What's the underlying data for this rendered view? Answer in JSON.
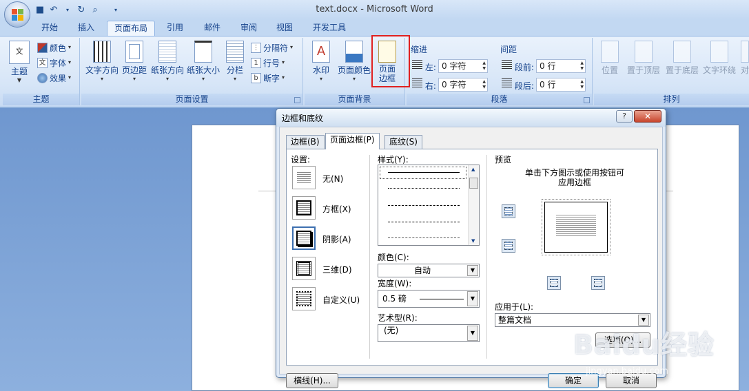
{
  "window": {
    "title": "text.docx - Microsoft Word"
  },
  "tabs": [
    "开始",
    "插入",
    "页面布局",
    "引用",
    "邮件",
    "审阅",
    "视图",
    "开发工具"
  ],
  "ribbon": {
    "themes": {
      "label": "主题",
      "theme_btn": "主题",
      "colors": "颜色",
      "fonts": "字体",
      "effects": "效果"
    },
    "page_setup": {
      "label": "页面设置",
      "text_direction": "文字方向",
      "margins": "页边距",
      "orientation": "纸张方向",
      "size": "纸张大小",
      "columns": "分栏",
      "breaks": "分隔符",
      "line_numbers": "行号",
      "hyphenation": "断字"
    },
    "page_background": {
      "label": "页面背景",
      "watermark": "水印",
      "page_color": "页面颜色",
      "page_borders_1": "页面",
      "page_borders_2": "边框"
    },
    "paragraph": {
      "label": "段落",
      "indent": "缩进",
      "left": "左:",
      "right": "右:",
      "left_val": "0 字符",
      "right_val": "0 字符",
      "spacing": "间距",
      "before": "段前:",
      "after": "段后:",
      "before_val": "0 行",
      "after_val": "0 行"
    },
    "arrange": {
      "label": "排列",
      "position": "位置",
      "bring_front": "置于顶层",
      "send_back": "置于底层",
      "wrap": "文字环绕",
      "align": "对"
    }
  },
  "dialog": {
    "title": "边框和底纹",
    "tabs": [
      "边框(B)",
      "页面边框(P)",
      "底纹(S)"
    ],
    "settings_label": "设置:",
    "settings": [
      "无(N)",
      "方框(X)",
      "阴影(A)",
      "三维(D)",
      "自定义(U)"
    ],
    "style_label": "样式(Y):",
    "color_label": "颜色(C):",
    "color_value": "自动",
    "width_label": "宽度(W):",
    "width_value": "0.5 磅",
    "art_label": "艺术型(R):",
    "art_value": "(无)",
    "preview_label": "预览",
    "preview_hint_1": "单击下方图示或使用按钮可",
    "preview_hint_2": "应用边框",
    "apply_label": "应用于(L):",
    "apply_value": "整篇文档",
    "options_btn": "选项(O)...",
    "hline_btn": "横线(H)...",
    "ok_btn": "确定",
    "cancel_btn": "取消"
  },
  "watermark": {
    "text": "Baidu经验",
    "sub": "jingyan.baidu.com"
  }
}
